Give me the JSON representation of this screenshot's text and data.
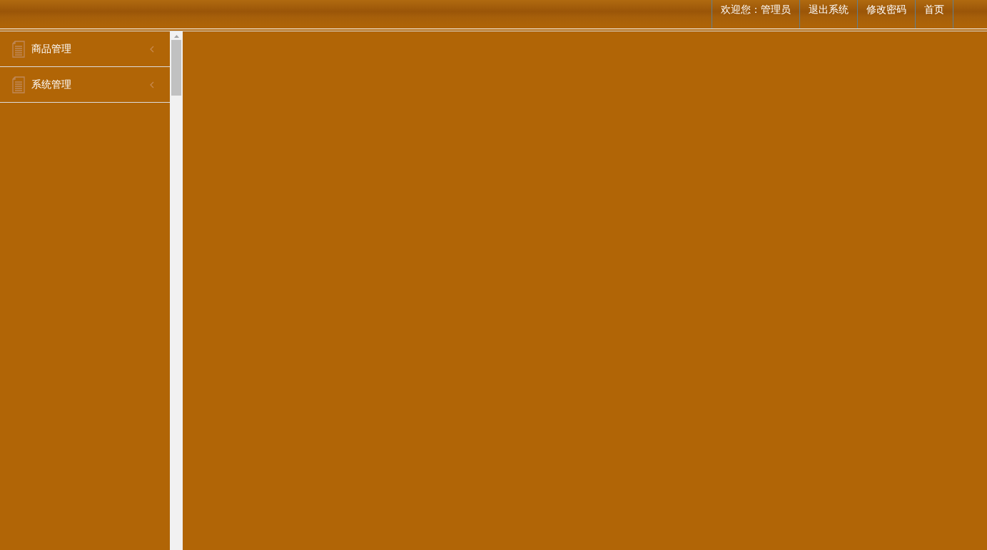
{
  "header": {
    "welcome": "欢迎您：管理员",
    "links": [
      "退出系统",
      "修改密码",
      "首页"
    ]
  },
  "sidebar": {
    "items": [
      {
        "label": "商品管理",
        "expanded": false
      },
      {
        "label": "系统管理",
        "expanded": false
      }
    ]
  }
}
